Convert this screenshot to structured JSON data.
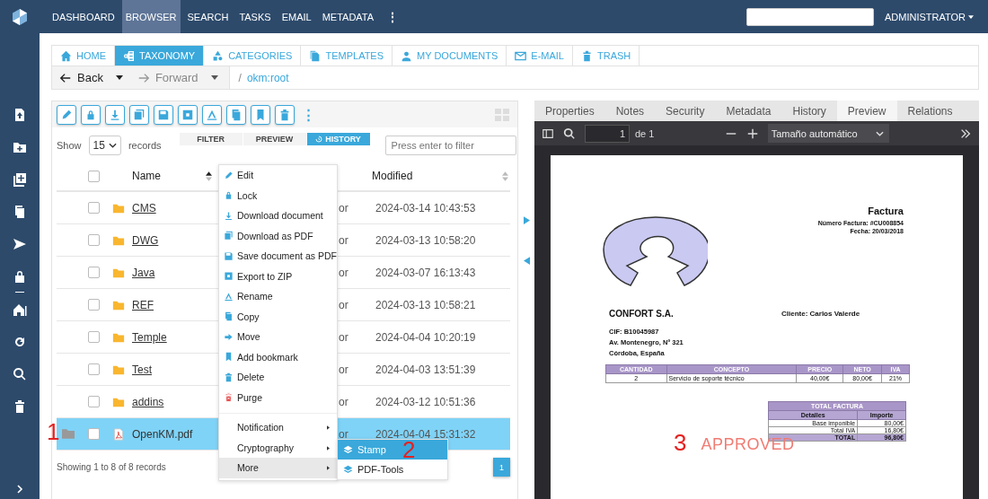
{
  "topbar": {
    "menu": [
      {
        "label": "DASHBOARD",
        "selected": false
      },
      {
        "label": "BROWSER",
        "selected": true
      },
      {
        "label": "SEARCH",
        "selected": false
      },
      {
        "label": "TASKS",
        "selected": false
      },
      {
        "label": "EMAIL",
        "selected": false
      },
      {
        "label": "METADATA",
        "selected": false
      }
    ],
    "more": "⋮",
    "user": "ADMINISTRATOR"
  },
  "nav_tabs": [
    {
      "label": "HOME",
      "selected": false
    },
    {
      "label": "TAXONOMY",
      "selected": true
    },
    {
      "label": "CATEGORIES",
      "selected": false
    },
    {
      "label": "TEMPLATES",
      "selected": false
    },
    {
      "label": "MY DOCUMENTS",
      "selected": false
    },
    {
      "label": "E-MAIL",
      "selected": false
    },
    {
      "label": "TRASH",
      "selected": false
    }
  ],
  "breadcrumb": {
    "back": "Back",
    "forward": "Forward",
    "separator": "/",
    "path": "okm:root"
  },
  "toolbar": {
    "more": "⋮"
  },
  "view_tabs": [
    {
      "label": "FILTER",
      "selected": false
    },
    {
      "label": "PREVIEW",
      "selected": false
    },
    {
      "label": "HISTORY",
      "selected": true
    }
  ],
  "show": {
    "label": "Show",
    "value": "15",
    "suffix": "records"
  },
  "filter": {
    "placeholder": "Press enter to filter"
  },
  "table": {
    "select_all": {
      "checked": false
    },
    "columns": [
      "Name",
      "Modified"
    ],
    "rows": [
      {
        "kind": "folder",
        "name": "CMS",
        "column_3": "or",
        "modified": "2024-03-14 10:43:53",
        "checked": false,
        "selected": false
      },
      {
        "kind": "folder",
        "name": "DWG",
        "column_3": "or",
        "modified": "2024-03-13 10:58:20",
        "checked": false,
        "selected": false
      },
      {
        "kind": "folder",
        "name": "Java",
        "column_3": "or",
        "modified": "2024-03-07 16:13:43",
        "checked": false,
        "selected": false
      },
      {
        "kind": "folder",
        "name": "REF",
        "column_3": "or",
        "modified": "2024-03-13 10:58:21",
        "checked": false,
        "selected": false
      },
      {
        "kind": "folder",
        "name": "Temple",
        "column_3": "or",
        "modified": "2024-04-04 10:20:19",
        "checked": false,
        "selected": false
      },
      {
        "kind": "folder",
        "name": "Test",
        "column_3": "or",
        "modified": "2024-04-03 13:51:39",
        "checked": false,
        "selected": false
      },
      {
        "kind": "folder",
        "name": "addins",
        "column_3": "or",
        "modified": "2024-03-12 10:51:36",
        "checked": false,
        "selected": false
      },
      {
        "kind": "pdf",
        "name": "OpenKM.pdf",
        "column_3": "or",
        "modified": "2024-04-04 15:31:32",
        "checked": false,
        "selected": true
      }
    ]
  },
  "footer": {
    "summary": "Showing 1 to 8 of 8 records",
    "pages": [
      {
        "label": "1",
        "selected": true
      }
    ]
  },
  "context_menu": {
    "items": [
      {
        "kind": "action",
        "label": "Edit"
      },
      {
        "kind": "action",
        "label": "Lock"
      },
      {
        "kind": "action",
        "label": "Download document"
      },
      {
        "kind": "action",
        "label": "Download as PDF"
      },
      {
        "kind": "action",
        "label": "Save document as PDF"
      },
      {
        "kind": "action",
        "label": "Export to ZIP"
      },
      {
        "kind": "action",
        "label": "Rename"
      },
      {
        "kind": "action",
        "label": "Copy"
      },
      {
        "kind": "action",
        "label": "Move"
      },
      {
        "kind": "action",
        "label": "Add bookmark"
      },
      {
        "kind": "action",
        "label": "Delete"
      },
      {
        "kind": "danger",
        "label": "Purge"
      },
      {
        "kind": "submenu",
        "label": "Notification",
        "expanded": false
      },
      {
        "kind": "submenu",
        "label": "Cryptography",
        "expanded": false
      },
      {
        "kind": "submenu",
        "label": "More",
        "expanded": true
      }
    ],
    "submenu": [
      {
        "label": "Stamp",
        "selected": true
      },
      {
        "label": "PDF-Tools",
        "selected": false
      }
    ]
  },
  "annotations": [
    "1",
    "2",
    "3"
  ],
  "preview": {
    "tabs": [
      {
        "label": "Properties",
        "selected": false
      },
      {
        "label": "Notes",
        "selected": false
      },
      {
        "label": "Security",
        "selected": false
      },
      {
        "label": "Metadata",
        "selected": false
      },
      {
        "label": "History",
        "selected": false
      },
      {
        "label": "Preview",
        "selected": true
      },
      {
        "label": "Relations",
        "selected": false
      }
    ],
    "toolbar": {
      "page": "1",
      "of": "de 1",
      "zoom": "Tamaño automático"
    },
    "document": {
      "title": "Factura",
      "number": "Número Factura: #CU008854",
      "date": "Fecha: 20/03/2018",
      "company": "CONFORT  S.A.",
      "client": "Cliente:  Carlos Valerde",
      "cif": "CIF:  B10045987",
      "address": "Av. Montenegro, Nº 321",
      "city": "Córdoba, España",
      "items": {
        "columns": [
          "CANTIDAD",
          "CONCEPTO",
          "PRECIO",
          "NETO",
          "IVA"
        ],
        "rows": [
          [
            "2",
            "Servicio de soporte técnico",
            "40,00€",
            "80,00€",
            "21%"
          ]
        ]
      },
      "totals": {
        "title": "TOTAL FACTURA",
        "columns": [
          "Detalles",
          "Importe"
        ],
        "rows": [
          [
            "Base imponible",
            "80,00€"
          ],
          [
            "Total IVA",
            "16,80€"
          ]
        ],
        "total": [
          "TOTAL",
          "96,80€"
        ]
      },
      "stamp": "APPROVED"
    }
  }
}
